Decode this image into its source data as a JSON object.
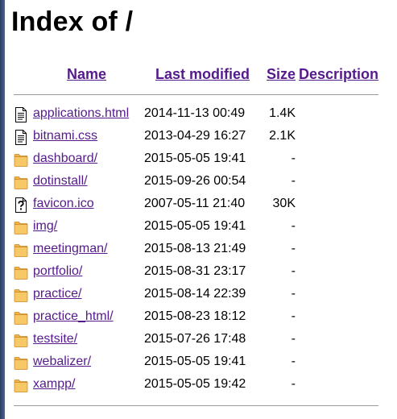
{
  "title": "Index of /",
  "columns": {
    "name": "Name",
    "modified": "Last modified",
    "size": "Size",
    "description": "Description"
  },
  "files": [
    {
      "icon": "document-icon",
      "name": "applications.html",
      "modified": "2014-11-13 00:49",
      "size": "1.4K"
    },
    {
      "icon": "document-icon",
      "name": "bitnami.css",
      "modified": "2013-04-29 16:27",
      "size": "2.1K"
    },
    {
      "icon": "folder-icon",
      "name": "dashboard/",
      "modified": "2015-05-05 19:41",
      "size": "-"
    },
    {
      "icon": "folder-icon",
      "name": "dotinstall/",
      "modified": "2015-09-26 00:54",
      "size": "-"
    },
    {
      "icon": "unknown-file-icon",
      "name": "favicon.ico",
      "modified": "2007-05-11 21:40",
      "size": "30K"
    },
    {
      "icon": "folder-icon",
      "name": "img/",
      "modified": "2015-05-05 19:41",
      "size": "-"
    },
    {
      "icon": "folder-icon",
      "name": "meetingman/",
      "modified": "2015-08-13 21:49",
      "size": "-"
    },
    {
      "icon": "folder-icon",
      "name": "portfolio/",
      "modified": "2015-08-31 23:17",
      "size": "-"
    },
    {
      "icon": "folder-icon",
      "name": "practice/",
      "modified": "2015-08-14 22:39",
      "size": "-"
    },
    {
      "icon": "folder-icon",
      "name": "practice_html/",
      "modified": "2015-08-23 18:12",
      "size": "-"
    },
    {
      "icon": "folder-icon",
      "name": "testsite/",
      "modified": "2015-07-26 17:48",
      "size": "-"
    },
    {
      "icon": "folder-icon",
      "name": "webalizer/",
      "modified": "2015-05-05 19:41",
      "size": "-"
    },
    {
      "icon": "folder-icon",
      "name": "xampp/",
      "modified": "2015-05-05 19:42",
      "size": "-"
    }
  ]
}
